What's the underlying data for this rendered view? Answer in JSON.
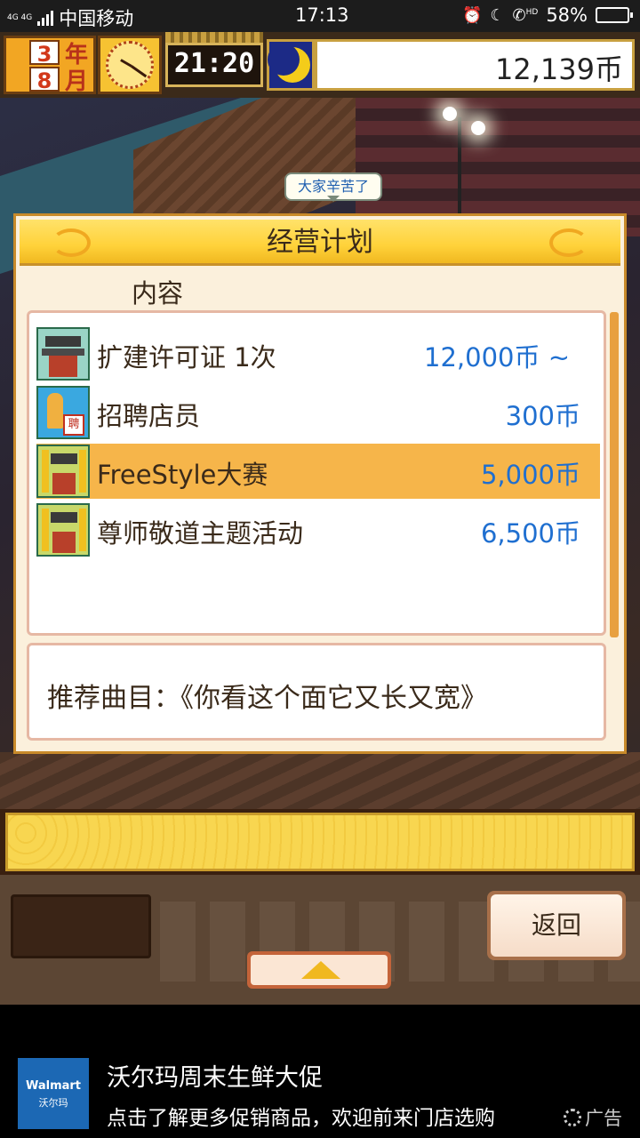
{
  "status_bar": {
    "network": "4G 4G",
    "carrier": "中国移动",
    "time": "17:13",
    "icons": [
      "alarm-icon",
      "moon-icon",
      "hd-call-icon"
    ],
    "hd_label": "HD",
    "battery_text": "58%",
    "battery_level": 0.58,
    "battery_color": "#35c14a"
  },
  "hud": {
    "year_num": "3",
    "year_unit": "年",
    "month_num": "8",
    "month_unit": "月",
    "game_time": "21:20",
    "money": "12,139币"
  },
  "speech_bubble": "大家辛苦了",
  "dialog": {
    "title": "经营计划",
    "section_label": "内容",
    "items": [
      {
        "name": "扩建许可证 1次",
        "price": "12,000币 ~",
        "icon": "building-icon",
        "selected": false
      },
      {
        "name": "招聘店员",
        "price": "300币",
        "icon": "recruit-icon",
        "selected": false
      },
      {
        "name": "FreeStyle大赛",
        "price": "5,000币",
        "icon": "boost-building-icon",
        "selected": true
      },
      {
        "name": "尊师敬道主题活动",
        "price": "6,500币",
        "icon": "boost-building-icon",
        "selected": false
      }
    ],
    "recruit_sign": "聘",
    "description": "推荐曲目：《你看这个面它又长又宽》"
  },
  "bottom": {
    "back_label": "返回",
    "up_icon": "triangle-up-icon"
  },
  "ad": {
    "logo_en": "Walmart",
    "logo_cn": "沃尔玛",
    "title": "沃尔玛周末生鲜大促",
    "subtitle": "点击了解更多促销商品，欢迎前来门店选购",
    "tag": "广告"
  },
  "colors": {
    "price_blue": "#1f6fd0",
    "selected_row": "#f6b54a",
    "title_gold": "#ffd23a"
  }
}
